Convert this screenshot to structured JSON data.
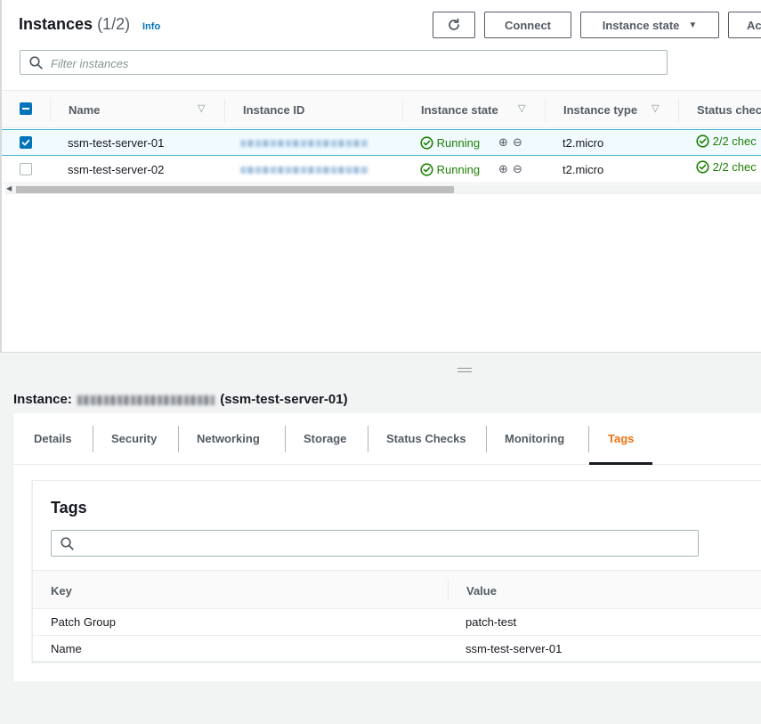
{
  "header": {
    "title": "Instances",
    "count": "(1/2)",
    "info_link": "Info",
    "connect_label": "Connect",
    "instance_state_label": "Instance state",
    "actions_label": "Ac"
  },
  "filter": {
    "placeholder": "Filter instances"
  },
  "columns": {
    "name": "Name",
    "instance_id": "Instance ID",
    "instance_state": "Instance state",
    "instance_type": "Instance type",
    "status_check": "Status chec"
  },
  "rows": [
    {
      "selected": true,
      "name": "ssm-test-server-01",
      "state": "Running",
      "type": "t2.micro",
      "status": "2/2 chec"
    },
    {
      "selected": false,
      "name": "ssm-test-server-02",
      "state": "Running",
      "type": "t2.micro",
      "status": "2/2 chec"
    }
  ],
  "detail": {
    "instance_label": "Instance:",
    "instance_name": "(ssm-test-server-01)",
    "tabs": [
      "Details",
      "Security",
      "Networking",
      "Storage",
      "Status Checks",
      "Monitoring",
      "Tags"
    ],
    "active_tab": "Tags"
  },
  "tags": {
    "title": "Tags",
    "search_value": "",
    "columns": {
      "key": "Key",
      "value": "Value"
    },
    "rows": [
      {
        "key": "Patch Group",
        "value": "patch-test"
      },
      {
        "key": "Name",
        "value": "ssm-test-server-01"
      }
    ]
  },
  "colors": {
    "accent": "#0073bb",
    "running": "#1d8102",
    "active_tab": "#ec7211",
    "selected_row_bg": "#f1faff"
  },
  "icons": {
    "refresh": "refresh-icon",
    "search": "search-icon",
    "sort": "sort-down-icon",
    "status_ok": "check-circle-icon",
    "zoom_in": "zoom-in-icon",
    "zoom_out": "zoom-out-icon"
  }
}
